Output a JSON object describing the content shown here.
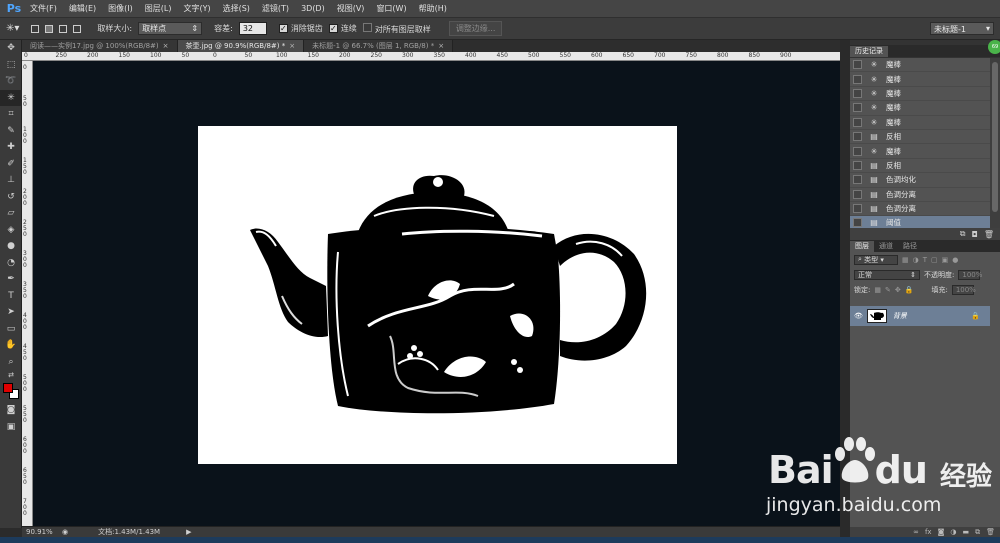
{
  "app": {
    "logo": "Ps"
  },
  "menu": [
    "文件(F)",
    "编辑(E)",
    "图像(I)",
    "图层(L)",
    "文字(Y)",
    "选择(S)",
    "滤镜(T)",
    "3D(D)",
    "视图(V)",
    "窗口(W)",
    "帮助(H)"
  ],
  "options": {
    "sample_size_label": "取样大小:",
    "sample_size_value": "取样点",
    "tolerance_label": "容差:",
    "tolerance_value": "32",
    "antialias_label": "消除锯齿",
    "contiguous_label": "连续",
    "sample_all_label": "对所有图层取样",
    "refine_edge_label": "调整边缘...",
    "workspace": "未标题-1"
  },
  "tabs": [
    {
      "label": "阅读——实例17.jpg @ 100%(RGB/8#)",
      "close": "×"
    },
    {
      "label": "茶壶.jpg @ 90.9%(RGB/8#) *",
      "close": "×"
    },
    {
      "label": "未标题-1 @ 66.7% (图层 1, RGB/8) *",
      "close": "×"
    }
  ],
  "ruler_top": [
    "0",
    "250",
    "200",
    "150",
    "100",
    "50",
    "0",
    "50",
    "100",
    "150",
    "200",
    "250",
    "300",
    "350",
    "400",
    "450",
    "500",
    "550",
    "600",
    "650",
    "700",
    "750",
    "800",
    "850",
    "900"
  ],
  "ruler_left": [
    "0",
    "50",
    "100",
    "150",
    "200",
    "250",
    "300",
    "350",
    "400",
    "450",
    "500",
    "550",
    "600",
    "650",
    "700"
  ],
  "status": {
    "zoom": "90.91%",
    "doc": "文档:1.43M/1.43M"
  },
  "history": {
    "title": "历史记录",
    "items": [
      {
        "icon": "magic-wand",
        "label": "魔棒"
      },
      {
        "icon": "magic-wand",
        "label": "魔棒"
      },
      {
        "icon": "magic-wand",
        "label": "魔棒"
      },
      {
        "icon": "magic-wand",
        "label": "魔棒"
      },
      {
        "icon": "magic-wand",
        "label": "魔棒"
      },
      {
        "icon": "document",
        "label": "反相"
      },
      {
        "icon": "magic-wand",
        "label": "魔棒"
      },
      {
        "icon": "document",
        "label": "反相"
      },
      {
        "icon": "document",
        "label": "色调均化"
      },
      {
        "icon": "document",
        "label": "色调分离"
      },
      {
        "icon": "document",
        "label": "色调分离"
      },
      {
        "icon": "document",
        "label": "阈值"
      }
    ]
  },
  "layers": {
    "tabs": [
      "图层",
      "通道",
      "路径"
    ],
    "kind": "类型",
    "blend": "正常",
    "opacity_label": "不透明度:",
    "opacity_value": "100%",
    "lock_label": "锁定:",
    "fill_label": "填充:",
    "fill_value": "100%",
    "layer_name": "背景"
  },
  "badge": "69",
  "watermark": {
    "brand": "Bai",
    "brand2": "du",
    "cn": "经验",
    "url": "jingyan.baidu.com"
  },
  "colors": {
    "foreground": "#e00000",
    "background": "#ffffff",
    "canvas_bg": "#0a121a",
    "selection": "#6d7f96"
  }
}
